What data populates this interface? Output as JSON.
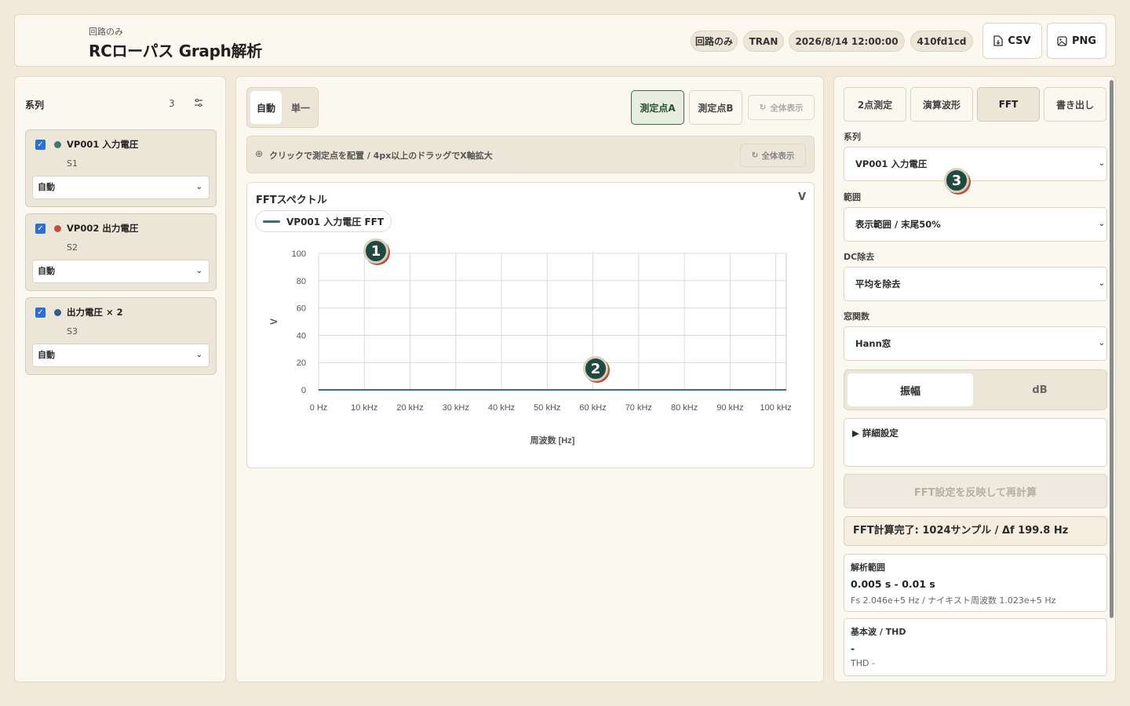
{
  "header": {
    "subtitle": "回路のみ",
    "title": "RCローパス Graph解析",
    "badges": [
      "回路のみ",
      "TRAN",
      "2026/8/14 12:00:00",
      "410fd1cd"
    ],
    "csv_label": "CSV",
    "png_label": "PNG"
  },
  "series_panel": {
    "title": "系列",
    "count": "3",
    "items": [
      {
        "name": "VP001 入力電圧",
        "code": "S1",
        "mode": "自動",
        "color": "#3d7a6a"
      },
      {
        "name": "VP002 出力電圧",
        "code": "S2",
        "mode": "自動",
        "color": "#b7533d"
      },
      {
        "name": "出力電圧 × 2",
        "code": "S3",
        "mode": "自動",
        "color": "#2f5d8a"
      }
    ]
  },
  "toolbar": {
    "mode_auto": "自動",
    "mode_single": "単一",
    "point_a": "測定点A",
    "point_b": "測定点B",
    "fit_all": "全体表示"
  },
  "hint": {
    "text": "クリックで測定点を配置 / 4px以上のドラッグでX軸拡大",
    "fit_all": "全体表示"
  },
  "chart_data": {
    "type": "line",
    "title": "FFTスペクトル",
    "unit": "V",
    "xlabel": "周波数 [Hz]",
    "ylabel": "V",
    "x_ticks": [
      "0 Hz",
      "10 kHz",
      "20 kHz",
      "30 kHz",
      "40 kHz",
      "50 kHz",
      "60 kHz",
      "70 kHz",
      "80 kHz",
      "90 kHz",
      "100 kHz"
    ],
    "y_ticks": [
      "0",
      "20",
      "40",
      "60",
      "80",
      "100"
    ],
    "xlim": [
      0,
      102300
    ],
    "ylim": [
      0,
      100
    ],
    "grid": true,
    "series": [
      {
        "name": "VP001 入力電圧 FFT",
        "color": "#3a6f6a",
        "x": [
          0,
          102300
        ],
        "y": [
          0,
          0
        ]
      }
    ]
  },
  "markers": [
    "1",
    "2",
    "3"
  ],
  "fft_panel": {
    "tabs": [
      "2点測定",
      "演算波形",
      "FFT",
      "書き出し"
    ],
    "active_tab": "FFT",
    "series_label": "系列",
    "series_value": "VP001 入力電圧",
    "range_label": "範囲",
    "range_value": "表示範囲 / 末尾50%",
    "dc_label": "DC除去",
    "dc_value": "平均を除去",
    "window_label": "窓関数",
    "window_value": "Hann窓",
    "scale_amp": "振幅",
    "scale_db": "dB",
    "details_label": "▶ 詳細設定",
    "recalc_label": "FFT設定を反映して再計算",
    "status": "FFT計算完了: 1024サンプル / Δf 199.8 Hz",
    "analysis_title": "解析範囲",
    "analysis_value": "0.005 s - 0.01 s",
    "analysis_detail": "Fs 2.046e+5 Hz / ナイキスト周波数 1.023e+5 Hz",
    "thd_title": "基本波 / THD",
    "thd_value": "-",
    "thd_detail": "THD -"
  }
}
